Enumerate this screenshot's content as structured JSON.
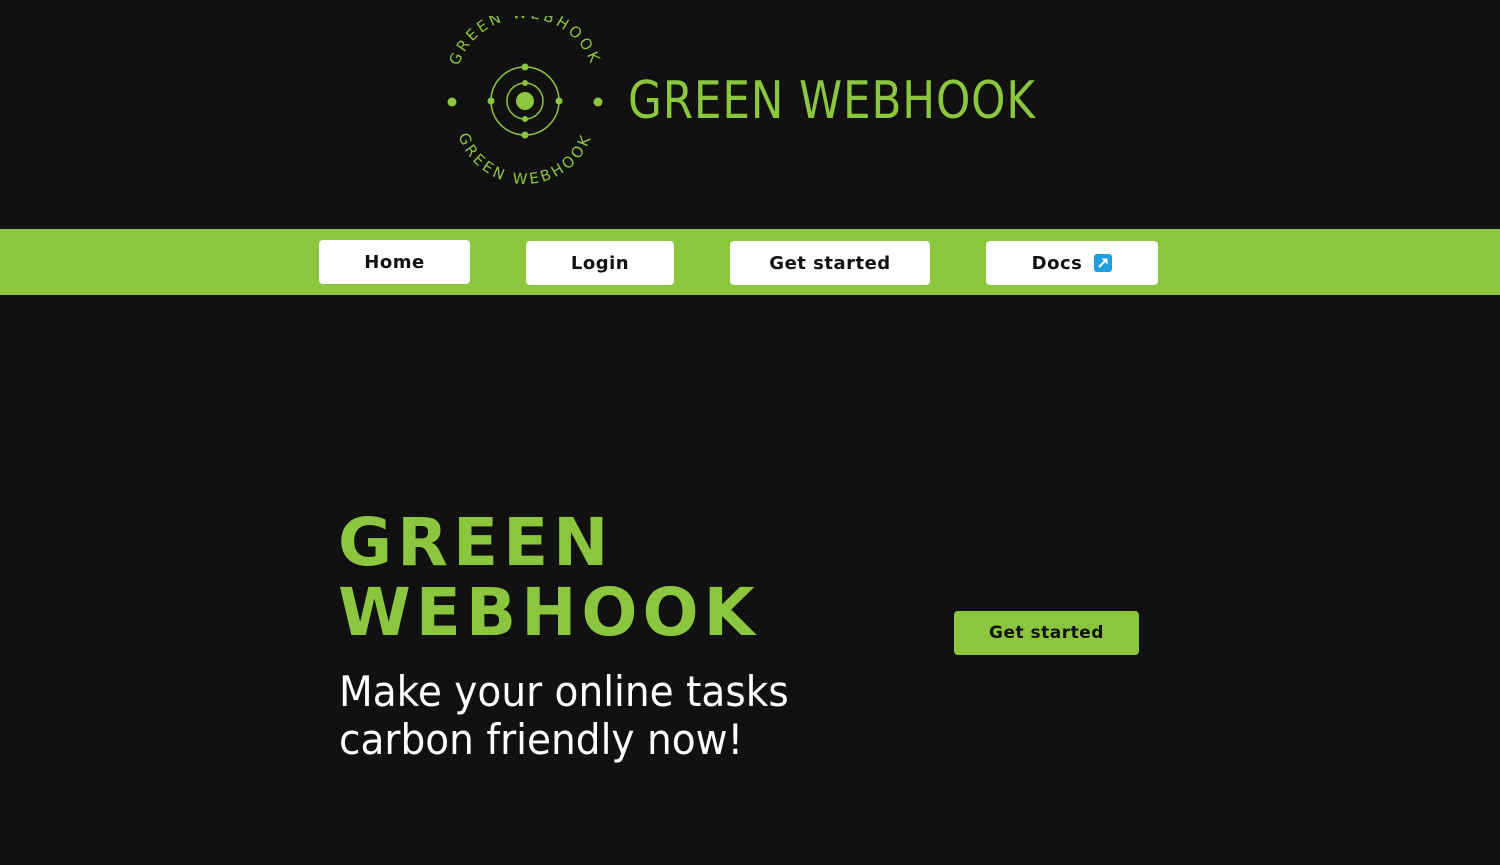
{
  "header": {
    "brand_name": "GREEN WEBHOOK",
    "seal_text_top": "GREEN WEBHOOK",
    "seal_text_bottom": "GREEN WEBHOOK",
    "logo_icon": "orbit-icon"
  },
  "nav": {
    "items": [
      {
        "label": "Home"
      },
      {
        "label": "Login"
      },
      {
        "label": "Get started"
      },
      {
        "label": "Docs",
        "icon": "external-link-icon"
      }
    ]
  },
  "hero": {
    "title_line1": "GREEN",
    "title_line2": "WEBHOOK",
    "subtitle_line1": "Make your online tasks",
    "subtitle_line2": "carbon friendly now!",
    "cta_label": "Get started"
  },
  "colors": {
    "background": "#111111",
    "accent_green": "#8cc63f",
    "nav_button_bg": "#ffffff",
    "external_icon_bg": "#1e9fe0",
    "text_light": "#ffffff",
    "text_dark": "#111111"
  }
}
